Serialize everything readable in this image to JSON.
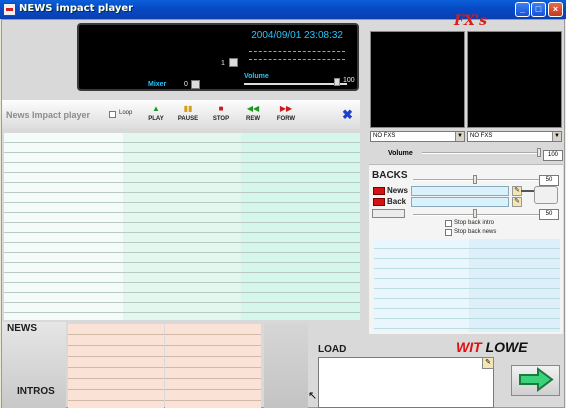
{
  "window": {
    "title": "NEWS impact player",
    "min_label": "_",
    "max_label": "□",
    "close_label": "×"
  },
  "display": {
    "datetime": "2004/09/01 23:08:32",
    "channel": "1",
    "mixer_label": "Mixer",
    "mixer_value": "0",
    "volume_label": "Volume",
    "volume_value": "100"
  },
  "toolbar": {
    "app_label": "News Impact player",
    "loop_label": "Loop",
    "buttons": [
      {
        "label": "PLAY",
        "icon": "▲",
        "color": "#1b9a22"
      },
      {
        "label": "PAUSE",
        "icon": "▮▮",
        "color": "#d4a017"
      },
      {
        "label": "STOP",
        "icon": "■",
        "color": "#cc1a1a"
      },
      {
        "label": "REW",
        "icon": "◀◀",
        "color": "#1b9a22"
      },
      {
        "label": "FORW",
        "icon": "▶▶",
        "color": "#cc1a1a"
      }
    ],
    "close_icon": "✖"
  },
  "fx": {
    "logo": "FX's",
    "select_left": "NO FXS",
    "select_right": "NO FXS",
    "volume_label": "Volume",
    "volume_value": "100"
  },
  "backs": {
    "title": "BACKS",
    "top_value": "50",
    "news_label": "News",
    "back_label": "Back",
    "bottom_value": "50",
    "stop_back_intro": "Stop back intro",
    "stop_back_news": "Stop back news"
  },
  "bottom": {
    "news_label": "NEWS",
    "intros_label": "INTROS",
    "load_label": "LOAD",
    "brand_a": "WIT",
    "brand_b": "LOWE"
  },
  "colors": {
    "grid_col1": "#F4FBF9",
    "grid_col2": "#E3F7EF",
    "grid_col3": "#D5F6EA",
    "news_grid": "#FBE2D6",
    "backs_col1": "#EAF6FD",
    "backs_col2": "#DCEFFB"
  }
}
